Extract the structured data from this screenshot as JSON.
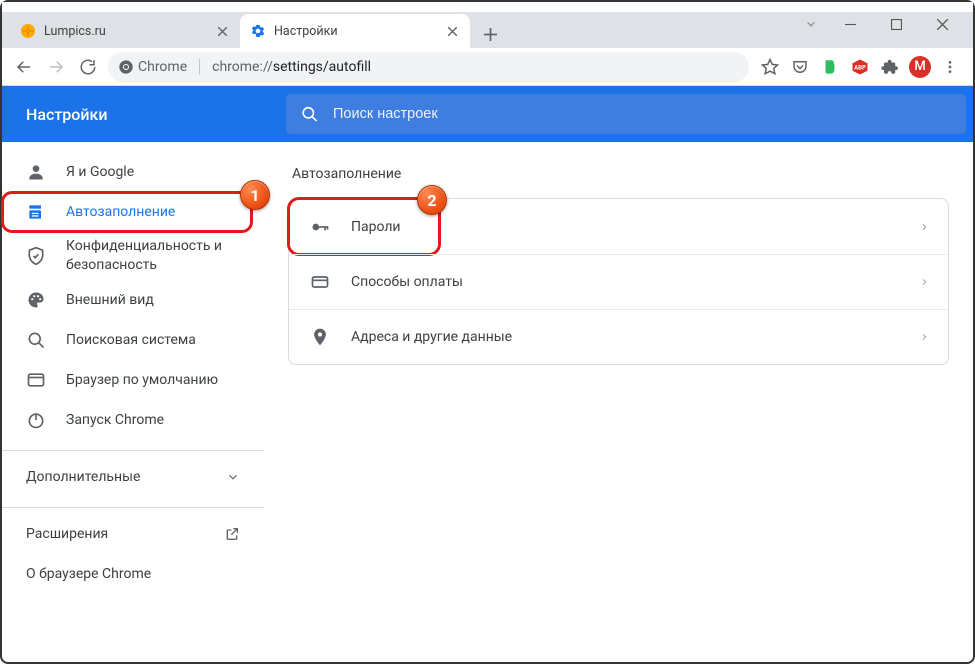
{
  "window": {
    "controls": {
      "pin": "⌄",
      "min": "─",
      "max": "☐",
      "close": "✕"
    }
  },
  "tabs": [
    {
      "title": "Lumpics.ru",
      "favicon_color": "#f29900"
    },
    {
      "title": "Настройки",
      "favicon_color": "#1a73e8"
    }
  ],
  "toolbar": {
    "secure_label": "Chrome",
    "url_scheme": "chrome://",
    "url_path": "settings/autofill",
    "extensions": [
      "star",
      "pocket",
      "evernote",
      "abp",
      "puzzle"
    ],
    "avatar_letter": "M"
  },
  "settings": {
    "title": "Настройки",
    "search_placeholder": "Поиск настроек"
  },
  "sidebar": {
    "items": [
      {
        "label": "Я и Google"
      },
      {
        "label": "Автозаполнение"
      },
      {
        "label": "Конфиденциальность и безопасность"
      },
      {
        "label": "Внешний вид"
      },
      {
        "label": "Поисковая система"
      },
      {
        "label": "Браузер по умолчанию"
      },
      {
        "label": "Запуск Chrome"
      }
    ],
    "advanced_label": "Дополнительные",
    "extensions_label": "Расширения",
    "about_label": "О браузере Chrome"
  },
  "main": {
    "section_title": "Автозаполнение",
    "rows": [
      {
        "label": "Пароли"
      },
      {
        "label": "Способы оплаты"
      },
      {
        "label": "Адреса и другие данные"
      }
    ]
  },
  "badges": {
    "b1": "1",
    "b2": "2"
  }
}
